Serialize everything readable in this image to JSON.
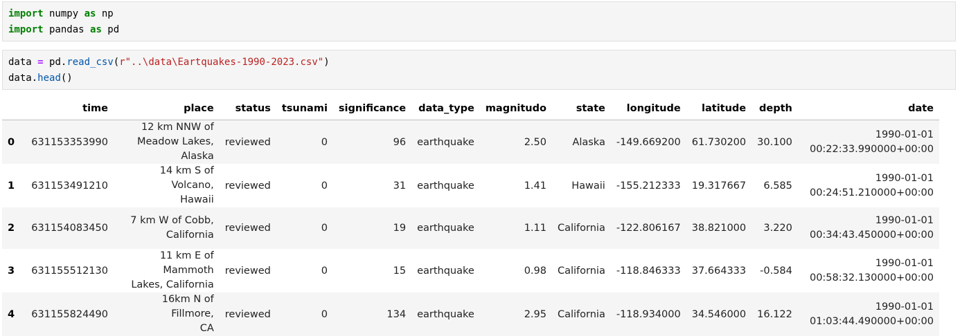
{
  "cells": {
    "cell1": {
      "line1": {
        "kw1": "import",
        "mod": " numpy ",
        "kw2": "as",
        "alias": " np"
      },
      "line2": {
        "kw1": "import",
        "mod": " pandas ",
        "kw2": "as",
        "alias": " pd"
      }
    },
    "cell2": {
      "line1": {
        "var": "data ",
        "op": "=",
        "obj": " pd.",
        "fn": "read_csv",
        "open": "(",
        "str": "r\"..\\data\\Eartquakes-1990-2023.csv\"",
        "close": ")"
      },
      "line2": {
        "obj": "data.",
        "fn": "head",
        "call": "()"
      }
    }
  },
  "table": {
    "columns": [
      "",
      "time",
      "place",
      "status",
      "tsunami",
      "significance",
      "data_type",
      "magnitudo",
      "state",
      "longitude",
      "latitude",
      "depth",
      "date"
    ],
    "rows": [
      {
        "idx": "0",
        "time": "631153353990",
        "place_a": "12 km NNW of",
        "place_b": "Meadow Lakes, Alaska",
        "status": "reviewed",
        "tsunami": "0",
        "significance": "96",
        "data_type": "earthquake",
        "magnitudo": "2.50",
        "state": "Alaska",
        "longitude": "-149.669200",
        "latitude": "61.730200",
        "depth": "30.100",
        "date_a": "1990-01-01",
        "date_b": "00:22:33.990000+00:00"
      },
      {
        "idx": "1",
        "time": "631153491210",
        "place_a": "14 km S of Volcano,",
        "place_b": "Hawaii",
        "status": "reviewed",
        "tsunami": "0",
        "significance": "31",
        "data_type": "earthquake",
        "magnitudo": "1.41",
        "state": "Hawaii",
        "longitude": "-155.212333",
        "latitude": "19.317667",
        "depth": "6.585",
        "date_a": "1990-01-01",
        "date_b": "00:24:51.210000+00:00"
      },
      {
        "idx": "2",
        "time": "631154083450",
        "place_a": "7 km W of Cobb,",
        "place_b": "California",
        "status": "reviewed",
        "tsunami": "0",
        "significance": "19",
        "data_type": "earthquake",
        "magnitudo": "1.11",
        "state": "California",
        "longitude": "-122.806167",
        "latitude": "38.821000",
        "depth": "3.220",
        "date_a": "1990-01-01",
        "date_b": "00:34:43.450000+00:00"
      },
      {
        "idx": "3",
        "time": "631155512130",
        "place_a": "11 km E of Mammoth",
        "place_b": "Lakes, California",
        "status": "reviewed",
        "tsunami": "0",
        "significance": "15",
        "data_type": "earthquake",
        "magnitudo": "0.98",
        "state": "California",
        "longitude": "-118.846333",
        "latitude": "37.664333",
        "depth": "-0.584",
        "date_a": "1990-01-01",
        "date_b": "00:58:32.130000+00:00"
      },
      {
        "idx": "4",
        "time": "631155824490",
        "place_a": "16km N of Fillmore,",
        "place_b": "CA",
        "status": "reviewed",
        "tsunami": "0",
        "significance": "134",
        "data_type": "earthquake",
        "magnitudo": "2.95",
        "state": "California",
        "longitude": "-118.934000",
        "latitude": "34.546000",
        "depth": "16.122",
        "date_a": "1990-01-01",
        "date_b": "01:03:44.490000+00:00"
      }
    ]
  }
}
